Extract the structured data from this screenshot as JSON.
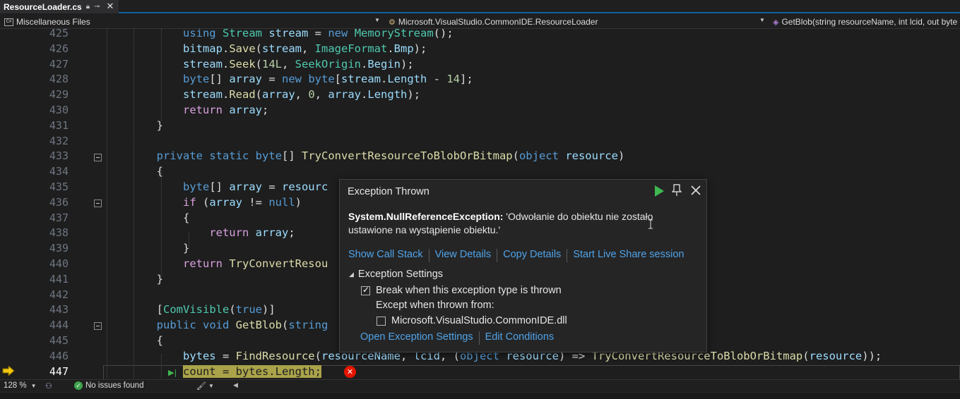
{
  "tab": {
    "name": "ResourceLoader.cs",
    "pin_icon": "pin-icon",
    "lock_icon": "lock-icon",
    "close_icon": "close-icon"
  },
  "navbar": {
    "project": "Miscellaneous Files",
    "class_path": "Microsoft.VisualStudio.CommonIDE.ResourceLoader",
    "method": "GetBlob(string resourceName, int lcid, out byte"
  },
  "editor": {
    "line_numbers": [
      "425",
      "426",
      "427",
      "428",
      "429",
      "430",
      "431",
      "432",
      "433",
      "434",
      "435",
      "436",
      "437",
      "438",
      "439",
      "440",
      "441",
      "442",
      "443",
      "444",
      "445",
      "446",
      "447"
    ],
    "current_line": "447",
    "line_447_statement": "count = bytes.Length;"
  },
  "exception_popup": {
    "title": "Exception Thrown",
    "exception_type": "System.NullReferenceException:",
    "message": " 'Odwołanie do obiektu nie zostało ustawione na wystąpienie obiektu.'",
    "links": [
      "Show Call Stack",
      "View Details",
      "Copy Details",
      "Start Live Share session"
    ],
    "settings_header": "Exception Settings",
    "break_label": "Break when this exception type is thrown",
    "except_label": "Except when thrown from:",
    "module_label": "Microsoft.VisualStudio.CommonIDE.dll",
    "break_checked": true,
    "module_checked": false,
    "bottom_links": [
      "Open Exception Settings",
      "Edit Conditions"
    ]
  },
  "status": {
    "zoom": "128 %",
    "issues": "No issues found"
  },
  "colors": {
    "accent": "#0e639c",
    "link": "#4fa3e8",
    "error": "#e51400",
    "ok": "#3fa34d"
  }
}
